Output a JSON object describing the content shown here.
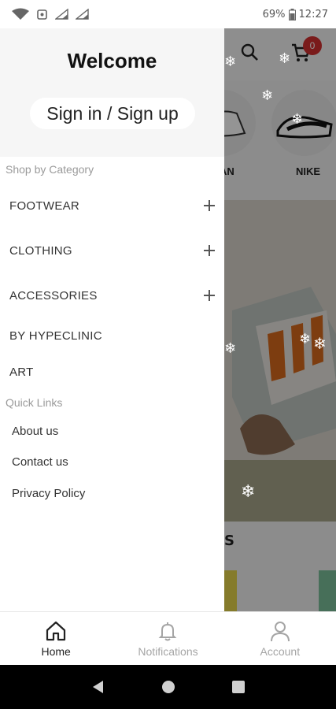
{
  "status_bar": {
    "battery": "69%",
    "time": "12:27"
  },
  "drawer": {
    "welcome": "Welcome",
    "signin_label": "Sign in / Sign up",
    "shop_by_category_label": "Shop by Category",
    "categories": [
      {
        "label": "FOOTWEAR",
        "expandable": true
      },
      {
        "label": "CLOTHING",
        "expandable": true
      },
      {
        "label": "ACCESSORIES",
        "expandable": true
      },
      {
        "label": "BY HYPECLINIC",
        "expandable": false
      },
      {
        "label": "ART",
        "expandable": false
      }
    ],
    "quick_links_label": "Quick Links",
    "quick_links": [
      "About us",
      "Contact us",
      "Privacy Policy"
    ]
  },
  "background": {
    "cart_count": "0",
    "brands": [
      "AN",
      "NIKE"
    ],
    "section_fragment": "S"
  },
  "bottom_nav": {
    "items": [
      {
        "label": "Home",
        "icon": "home-icon",
        "active": true
      },
      {
        "label": "Notifications",
        "icon": "bell-icon",
        "active": false
      },
      {
        "label": "Account",
        "icon": "person-icon",
        "active": false
      }
    ]
  },
  "colors": {
    "badge": "#d32f2f",
    "overlay": "rgba(0,0,0,0.42)",
    "muted_text": "#9a9a9a"
  }
}
